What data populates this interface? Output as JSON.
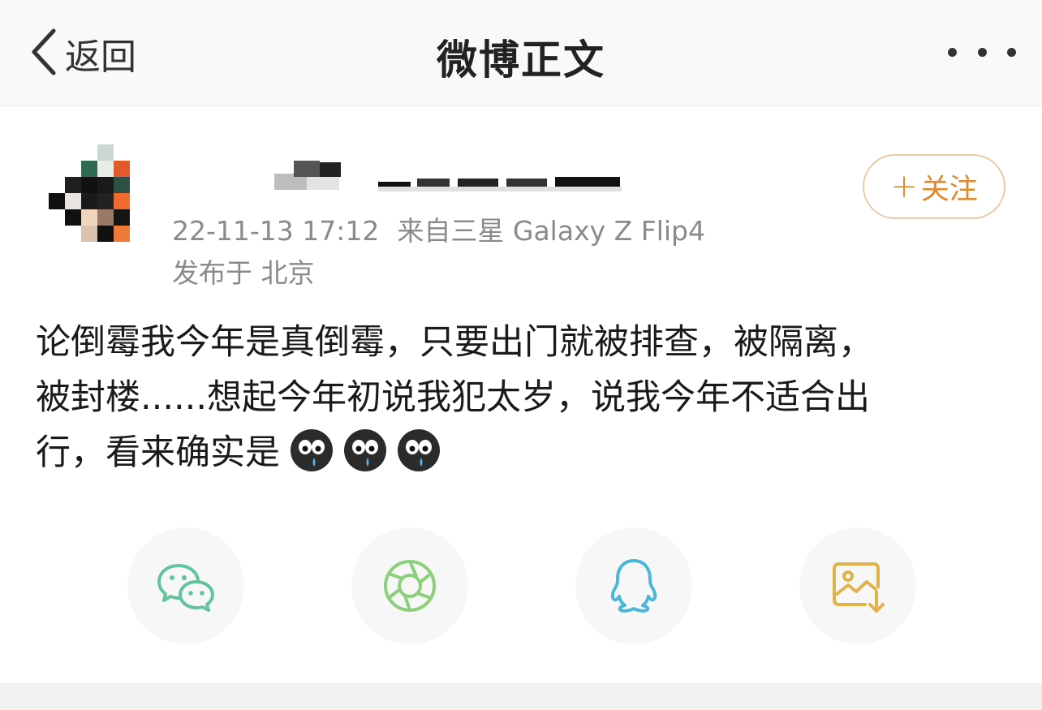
{
  "nav": {
    "back_label": "返回",
    "title": "微博正文",
    "more_icon": "more-icon"
  },
  "post": {
    "timestamp": "22-11-13 17:12",
    "source": "来自三星 Galaxy Z Flip4",
    "location": "发布于 北京",
    "follow_label": "关注",
    "content_lines": [
      "论倒霉我今年是真倒霉，只要出门就被排查，被隔离，",
      "被封楼......想起今年初说我犯太岁，说我今年不适合出",
      "行，看来确实是"
    ],
    "emoji_icons": [
      "crying-face-icon",
      "crying-face-icon",
      "crying-face-icon"
    ]
  },
  "share": {
    "icons": [
      "wechat-icon",
      "moments-icon",
      "qq-icon",
      "save-image-icon"
    ]
  },
  "colors": {
    "accent_orange": "#e08a2e",
    "follow_border": "#e8c9a8",
    "meta_gray": "#8a8a8a",
    "wechat_green": "#62c49c",
    "moments_green": "#8ccf7a",
    "qq_blue": "#4cb6d9",
    "save_gold": "#e0b24a"
  }
}
